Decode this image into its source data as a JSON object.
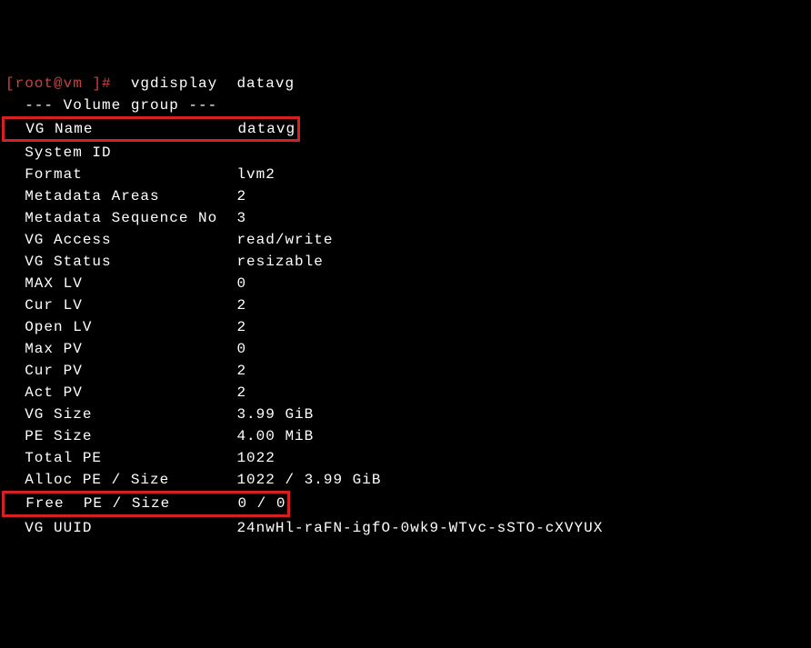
{
  "prompt": {
    "user": "[root@vm ]#",
    "command": "  vgdisplay  datavg"
  },
  "header": "  --- Volume group ---",
  "rows": [
    {
      "label": "  VG Name              ",
      "value": " datavg",
      "highlight": true
    },
    {
      "label": "  System ID            ",
      "value": "",
      "highlight": false
    },
    {
      "label": "  Format               ",
      "value": " lvm2",
      "highlight": false
    },
    {
      "label": "  Metadata Areas       ",
      "value": " 2",
      "highlight": false
    },
    {
      "label": "  Metadata Sequence No ",
      "value": " 3",
      "highlight": false
    },
    {
      "label": "  VG Access            ",
      "value": " read/write",
      "highlight": false
    },
    {
      "label": "  VG Status            ",
      "value": " resizable",
      "highlight": false
    },
    {
      "label": "  MAX LV               ",
      "value": " 0",
      "highlight": false
    },
    {
      "label": "  Cur LV               ",
      "value": " 2",
      "highlight": false
    },
    {
      "label": "  Open LV              ",
      "value": " 2",
      "highlight": false
    },
    {
      "label": "  Max PV               ",
      "value": " 0",
      "highlight": false
    },
    {
      "label": "  Cur PV               ",
      "value": " 2",
      "highlight": false
    },
    {
      "label": "  Act PV               ",
      "value": " 2",
      "highlight": false
    },
    {
      "label": "  VG Size              ",
      "value": " 3.99 GiB",
      "highlight": false
    },
    {
      "label": "  PE Size              ",
      "value": " 4.00 MiB",
      "highlight": false
    },
    {
      "label": "  Total PE             ",
      "value": " 1022",
      "highlight": false
    },
    {
      "label": "  Alloc PE / Size      ",
      "value": " 1022 / 3.99 GiB",
      "highlight": false
    },
    {
      "label": "  Free  PE / Size      ",
      "value": " 0 / 0",
      "highlight": true
    },
    {
      "label": "  VG UUID              ",
      "value": " 24nwHl-raFN-igfO-0wk9-WTvc-sSTO-cXVYUX",
      "highlight": false
    }
  ]
}
